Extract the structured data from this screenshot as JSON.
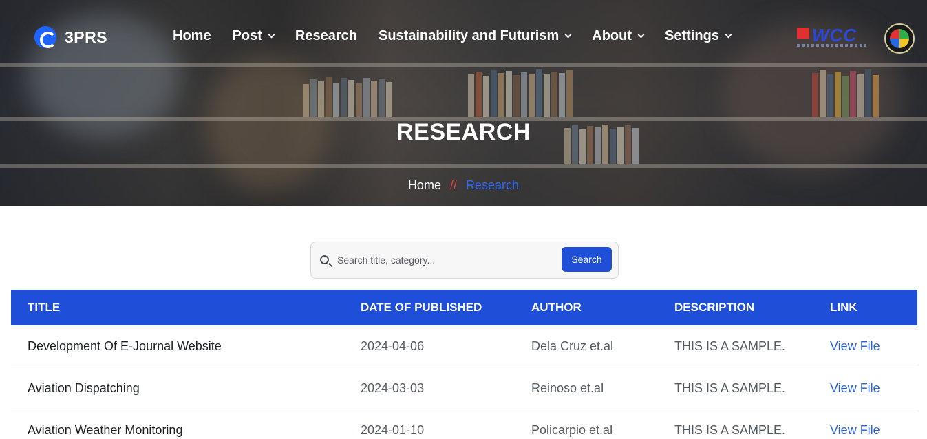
{
  "brand": {
    "name": "3PRS"
  },
  "nav": {
    "items": [
      {
        "label": "Home",
        "dropdown": false
      },
      {
        "label": "Post",
        "dropdown": true
      },
      {
        "label": "Research",
        "dropdown": false
      },
      {
        "label": "Sustainability and Futurism",
        "dropdown": true
      },
      {
        "label": "About",
        "dropdown": true
      },
      {
        "label": "Settings",
        "dropdown": true
      }
    ]
  },
  "logos": {
    "wcc": "WCC"
  },
  "hero": {
    "title": "RESEARCH",
    "breadcrumb": {
      "home": "Home",
      "separator": "//",
      "current": "Research"
    }
  },
  "search": {
    "placeholder": "Search title, category...",
    "button_label": "Search"
  },
  "table": {
    "headers": [
      "TITLE",
      "DATE OF PUBLISHED",
      "AUTHOR",
      "DESCRIPTION",
      "LINK"
    ],
    "rows": [
      {
        "title": "Development Of E-Journal Website",
        "date": "2024-04-06",
        "author": "Dela Cruz et.al",
        "description": "THIS IS A SAMPLE.",
        "link": "View File"
      },
      {
        "title": "Aviation Dispatching",
        "date": "2024-03-03",
        "author": "Reinoso et.al",
        "description": "THIS IS A SAMPLE.",
        "link": "View File"
      },
      {
        "title": "Aviation Weather Monitoring",
        "date": "2024-01-10",
        "author": "Policarpio et.al",
        "description": "THIS IS A SAMPLE.",
        "link": "View File"
      }
    ]
  },
  "colors": {
    "accent": "#1f4fd8",
    "breadcrumb_separator": "#e0443a",
    "breadcrumb_current": "#3068ff",
    "link": "#2a62d8"
  }
}
